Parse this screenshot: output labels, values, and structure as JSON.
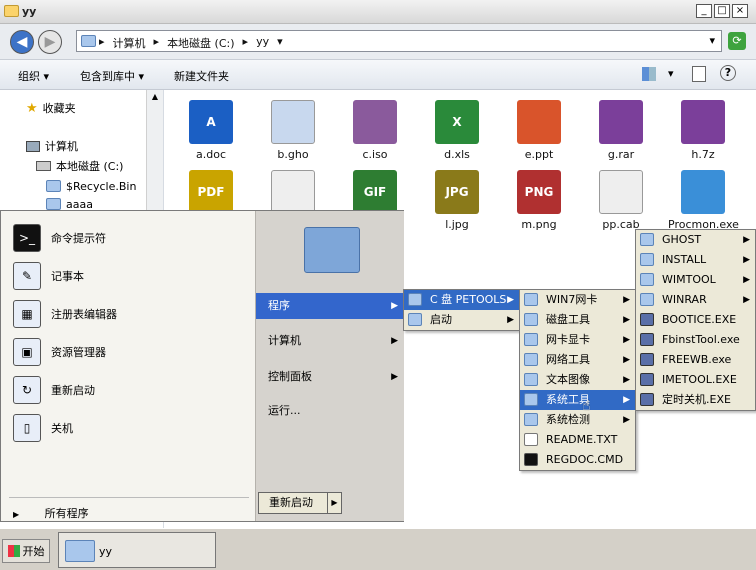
{
  "window": {
    "title": "yy",
    "minimize": "_",
    "maximize": "□",
    "close": "×"
  },
  "address": {
    "crumbs": [
      "计算机",
      "本地磁盘 (C:)",
      "yy"
    ]
  },
  "toolbar": {
    "organize": "组织",
    "include_library": "包含到库中",
    "new_folder": "新建文件夹"
  },
  "nav": {
    "favorites": "收藏夹",
    "computer": "计算机",
    "drive": "本地磁盘 (C:)",
    "recycle": "$Recycle.Bin",
    "folder": "aaaa"
  },
  "files": [
    {
      "name": "a.doc",
      "icon": "word-icon",
      "color": "#1b5fc4",
      "glyph": "A"
    },
    {
      "name": "b.gho",
      "icon": "ghost-icon",
      "color": "#c8d8ee",
      "glyph": ""
    },
    {
      "name": "c.iso",
      "icon": "disc-icon",
      "color": "#8a5a9c",
      "glyph": ""
    },
    {
      "name": "d.xls",
      "icon": "excel-icon",
      "color": "#2a8a3a",
      "glyph": "X"
    },
    {
      "name": "e.ppt",
      "icon": "ppt-icon",
      "color": "#d9542b",
      "glyph": ""
    },
    {
      "name": "g.rar",
      "icon": "rar-icon",
      "color": "#7b3f9a",
      "glyph": ""
    },
    {
      "name": "h.7z",
      "icon": "rar-icon",
      "color": "#7b3f9a",
      "glyph": ""
    },
    {
      "name": "",
      "icon": "pdf-icon",
      "color": "#c9a400",
      "glyph": "PDF"
    },
    {
      "name": "",
      "icon": "text-icon",
      "color": "#eeeeee",
      "glyph": ""
    },
    {
      "name": "",
      "icon": "gif-icon",
      "color": "#2e7d32",
      "glyph": "GIF"
    },
    {
      "name": "l.jpg",
      "icon": "jpg-icon",
      "color": "#8a7a1a",
      "glyph": "JPG"
    },
    {
      "name": "m.png",
      "icon": "png-icon",
      "color": "#b03030",
      "glyph": "PNG"
    },
    {
      "name": "pp.cab",
      "icon": "file-icon",
      "color": "#eeeeee",
      "glyph": ""
    },
    {
      "name": "Procmon.exe",
      "icon": "windows-icon",
      "color": "#3a8fd8",
      "glyph": ""
    }
  ],
  "start_left": [
    {
      "label": "命令提示符",
      "icon": "cmd-icon",
      "glyph": ">_"
    },
    {
      "label": "记事本",
      "icon": "notepad-icon",
      "glyph": "✎"
    },
    {
      "label": "注册表编辑器",
      "icon": "regedit-icon",
      "glyph": "▦"
    },
    {
      "label": "资源管理器",
      "icon": "explorer-icon",
      "glyph": "▣"
    },
    {
      "label": "重新启动",
      "icon": "restart-icon",
      "glyph": "↻"
    },
    {
      "label": "关机",
      "icon": "shutdown-icon",
      "glyph": "▯"
    }
  ],
  "all_programs": "所有程序",
  "start_right": [
    {
      "label": "程序",
      "arrow": true,
      "selected": true
    },
    {
      "label": "计算机",
      "arrow": true,
      "selected": false
    },
    {
      "label": "控制面板",
      "arrow": true,
      "selected": false
    },
    {
      "label": "运行...",
      "arrow": false,
      "selected": false
    }
  ],
  "restart_btn": "重新启动",
  "menu1": [
    {
      "label": "C 盘 PETOOLS",
      "arrow": true,
      "selected": true
    },
    {
      "label": "启动",
      "arrow": true,
      "selected": false
    }
  ],
  "menu2": [
    {
      "label": "WIN7网卡",
      "arrow": true,
      "selected": false
    },
    {
      "label": "磁盘工具",
      "arrow": true,
      "selected": false
    },
    {
      "label": "网卡显卡",
      "arrow": true,
      "selected": false
    },
    {
      "label": "网络工具",
      "arrow": true,
      "selected": false
    },
    {
      "label": "文本图像",
      "arrow": true,
      "selected": false
    },
    {
      "label": "系统工具",
      "arrow": true,
      "selected": true
    },
    {
      "label": "系统检测",
      "arrow": true,
      "selected": false
    },
    {
      "label": "README.TXT",
      "arrow": false,
      "selected": false
    },
    {
      "label": "REGDOC.CMD",
      "arrow": false,
      "selected": false
    }
  ],
  "menu3": [
    {
      "label": "GHOST",
      "arrow": true
    },
    {
      "label": "INSTALL",
      "arrow": true
    },
    {
      "label": "WIMTOOL",
      "arrow": true
    },
    {
      "label": "WINRAR",
      "arrow": true
    },
    {
      "label": "BOOTICE.EXE",
      "arrow": false
    },
    {
      "label": "FbinstTool.exe",
      "arrow": false
    },
    {
      "label": "FREEWB.exe",
      "arrow": false
    },
    {
      "label": "IMETOOL.EXE",
      "arrow": false
    },
    {
      "label": "定时关机.EXE",
      "arrow": false
    }
  ],
  "taskbar": {
    "start": "开始",
    "task": "yy"
  }
}
